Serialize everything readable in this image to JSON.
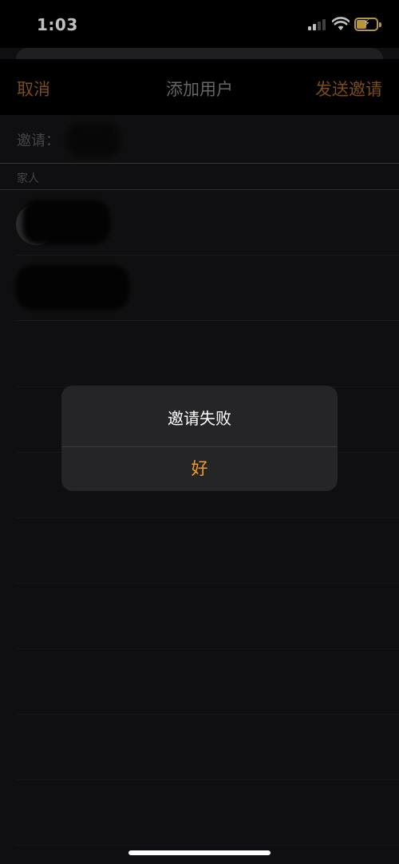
{
  "status_bar": {
    "time": "1:03"
  },
  "nav": {
    "cancel_label": "取消",
    "title": "添加用户",
    "send_label": "发送邀请"
  },
  "invite": {
    "label": "邀请："
  },
  "section": {
    "family_header": "家人"
  },
  "alert": {
    "title": "邀请失败",
    "ok_label": "好"
  },
  "colors": {
    "accent_dim": "#a3661e",
    "accent": "#f09a2a",
    "background": "#151517"
  },
  "icons": [
    "signal-icon",
    "wifi-icon",
    "battery-charging-icon"
  ]
}
